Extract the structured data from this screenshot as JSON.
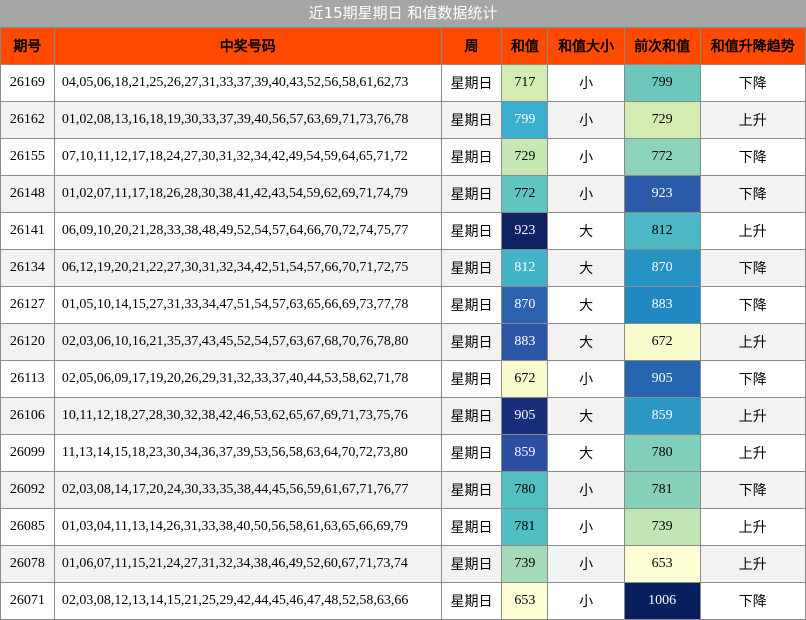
{
  "title": "近15期星期日 和值数据统计",
  "headers": [
    "期号",
    "中奖号码",
    "周",
    "和值",
    "和值大小",
    "前次和值",
    "和值升降趋势"
  ],
  "rows": [
    {
      "issue": "26169",
      "numbers": "04,05,06,18,21,25,26,27,31,33,37,39,40,43,52,56,58,61,62,73",
      "week": "星期日",
      "sum": "717",
      "size": "小",
      "prev_sum": "799",
      "trend": "下降",
      "sum_color": "#d4ecb2",
      "prev_color": "#6ec7bf"
    },
    {
      "issue": "26162",
      "numbers": "01,02,08,13,16,18,19,30,33,37,39,40,56,57,63,69,71,73,76,78",
      "week": "星期日",
      "sum": "799",
      "size": "小",
      "prev_sum": "729",
      "trend": "上升",
      "sum_color": "#3aaecf",
      "prev_color": "#d4ecb2"
    },
    {
      "issue": "26155",
      "numbers": "07,10,11,12,17,18,24,27,30,31,32,34,42,49,54,59,64,65,71,72",
      "week": "星期日",
      "sum": "729",
      "size": "小",
      "prev_sum": "772",
      "trend": "下降",
      "sum_color": "#c6e8b4",
      "prev_color": "#8dd3b9"
    },
    {
      "issue": "26148",
      "numbers": "01,02,07,11,17,18,26,28,30,38,41,42,43,54,59,62,69,71,74,79",
      "week": "星期日",
      "sum": "772",
      "size": "小",
      "prev_sum": "923",
      "trend": "下降",
      "sum_color": "#60c4c0",
      "prev_color": "#2a5aa8"
    },
    {
      "issue": "26141",
      "numbers": "06,09,10,20,21,28,33,38,48,49,52,54,57,64,66,70,72,74,75,77",
      "week": "星期日",
      "sum": "923",
      "size": "大",
      "prev_sum": "812",
      "trend": "上升",
      "sum_color": "#0d2163",
      "prev_color": "#4bb8c4"
    },
    {
      "issue": "26134",
      "numbers": "06,12,19,20,21,22,27,30,31,32,34,42,51,54,57,66,70,71,72,75",
      "week": "星期日",
      "sum": "812",
      "size": "大",
      "prev_sum": "870",
      "trend": "下降",
      "sum_color": "#43b3c8",
      "prev_color": "#2592c2"
    },
    {
      "issue": "26127",
      "numbers": "01,05,10,14,15,27,31,33,34,47,51,54,57,63,65,66,69,73,77,78",
      "week": "星期日",
      "sum": "870",
      "size": "大",
      "prev_sum": "883",
      "trend": "下降",
      "sum_color": "#2c62ae",
      "prev_color": "#2088c0"
    },
    {
      "issue": "26120",
      "numbers": "02,03,06,10,16,21,35,37,43,45,52,54,57,63,67,68,70,76,78,80",
      "week": "星期日",
      "sum": "883",
      "size": "大",
      "prev_sum": "672",
      "trend": "上升",
      "sum_color": "#2b56a6",
      "prev_color": "#fafbcc"
    },
    {
      "issue": "26113",
      "numbers": "02,05,06,09,17,19,20,26,29,31,32,33,37,40,44,53,58,62,71,78",
      "week": "星期日",
      "sum": "672",
      "size": "小",
      "prev_sum": "905",
      "trend": "下降",
      "sum_color": "#fafbcc",
      "prev_color": "#2666b0"
    },
    {
      "issue": "26106",
      "numbers": "10,11,12,18,27,28,30,32,38,42,46,53,62,65,67,69,71,73,75,76",
      "week": "星期日",
      "sum": "905",
      "size": "大",
      "prev_sum": "859",
      "trend": "上升",
      "sum_color": "#182e7a",
      "prev_color": "#2a98c3"
    },
    {
      "issue": "26099",
      "numbers": "11,13,14,15,18,23,30,34,36,37,39,53,56,58,63,64,70,72,73,80",
      "week": "星期日",
      "sum": "859",
      "size": "大",
      "prev_sum": "780",
      "trend": "上升",
      "sum_color": "#2a4ea2",
      "prev_color": "#82cfbc"
    },
    {
      "issue": "26092",
      "numbers": "02,03,08,14,17,20,24,30,33,35,38,44,45,56,59,61,67,71,76,77",
      "week": "星期日",
      "sum": "780",
      "size": "小",
      "prev_sum": "781",
      "trend": "下降",
      "sum_color": "#52bfc3",
      "prev_color": "#87d1bb"
    },
    {
      "issue": "26085",
      "numbers": "01,03,04,11,13,14,26,31,33,38,40,50,56,58,61,63,65,66,69,79",
      "week": "星期日",
      "sum": "781",
      "size": "小",
      "prev_sum": "739",
      "trend": "上升",
      "sum_color": "#50bdc4",
      "prev_color": "#c0e6b5"
    },
    {
      "issue": "26078",
      "numbers": "01,06,07,11,15,21,24,27,31,32,34,38,46,49,52,60,67,71,73,74",
      "week": "星期日",
      "sum": "739",
      "size": "小",
      "prev_sum": "653",
      "trend": "上升",
      "sum_color": "#a5dab8",
      "prev_color": "#ffffd6"
    },
    {
      "issue": "26071",
      "numbers": "02,03,08,12,13,14,15,21,25,29,42,44,45,46,47,48,52,58,63,66",
      "week": "星期日",
      "sum": "653",
      "size": "小",
      "prev_sum": "1006",
      "trend": "下降",
      "sum_color": "#ffffd6",
      "prev_color": "#08205e"
    }
  ]
}
